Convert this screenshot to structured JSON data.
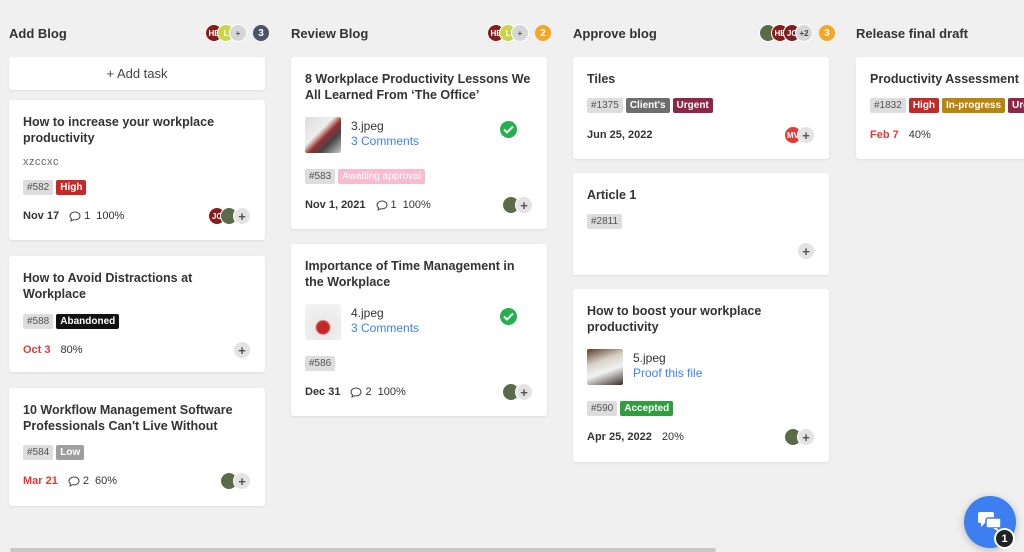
{
  "colors": {
    "high": "#c62828",
    "low": "#9e9e9e",
    "abandoned": "#111111",
    "awaiting": "#f8bbd0",
    "clients": "#6d6d6d",
    "urgent": "#8e2746",
    "inprogress": "#b8860b",
    "accepted": "#2e9e3e",
    "blue_badge": "#4a5568",
    "orange_badge": "#f5a623"
  },
  "columns": [
    {
      "title": "Add Blog",
      "avatars": [
        "HE",
        "L",
        "+"
      ],
      "count": "3",
      "add_task": "+ Add task",
      "cards": [
        {
          "title": "How to increase your workplace productivity",
          "subtitle": "xzccxc",
          "tags": [
            "#582",
            "High"
          ],
          "date": "Nov 17",
          "comments": "1",
          "progress": "100%",
          "avatars": [
            "JC",
            "photo"
          ]
        },
        {
          "title": "How to Avoid Distractions at Workplace",
          "tags": [
            "#588",
            "Abandoned"
          ],
          "date": "Oct 3",
          "progress": "80%"
        },
        {
          "title": "10 Workflow Management Software Professionals Can't Live Without",
          "tags": [
            "#584",
            "Low"
          ],
          "date": "Mar 21",
          "comments": "2",
          "progress": "60%",
          "avatars": [
            "photo"
          ]
        }
      ]
    },
    {
      "title": "Review Blog",
      "avatars": [
        "HE",
        "L",
        "+"
      ],
      "count": "2",
      "cards": [
        {
          "title": "8 Workplace Productivity Lessons We All Learned From ‘The Office’",
          "file": "3.jpeg",
          "file_link": "3 Comments",
          "tags": [
            "#583",
            "Awaiting approval"
          ],
          "date": "Nov 1, 2021",
          "comments": "1",
          "progress": "100%",
          "avatars": [
            "photo"
          ]
        },
        {
          "title": "Importance of Time Management in the Workplace",
          "file": "4.jpeg",
          "file_link": "3 Comments",
          "tags": [
            "#586"
          ],
          "date": "Dec 31",
          "comments": "2",
          "progress": "100%",
          "avatars": [
            "photo"
          ]
        }
      ]
    },
    {
      "title": "Approve blog",
      "avatars": [
        "photo",
        "HE",
        "JC",
        "+2"
      ],
      "count": "3",
      "cards": [
        {
          "title": "Tiles",
          "tags": [
            "#1375",
            "Client's",
            "Urgent"
          ],
          "date": "Jun 25, 2022",
          "avatars": [
            "MV"
          ]
        },
        {
          "title": "Article 1",
          "tags": [
            "#2811"
          ]
        },
        {
          "title": "How to boost your workplace productivity",
          "file": "5.jpeg",
          "file_link": "Proof this file",
          "tags": [
            "#590",
            "Accepted"
          ],
          "date": "Apr 25, 2022",
          "progress": "20%",
          "avatars": [
            "photo"
          ]
        }
      ]
    },
    {
      "title": "Release final draft",
      "cards": [
        {
          "title": "Productivity Assessment",
          "tags": [
            "#1832",
            "High",
            "In-progress",
            "Urg"
          ],
          "date": "Feb 7",
          "progress": "40%"
        }
      ]
    }
  ],
  "chat": {
    "badge": "1"
  }
}
